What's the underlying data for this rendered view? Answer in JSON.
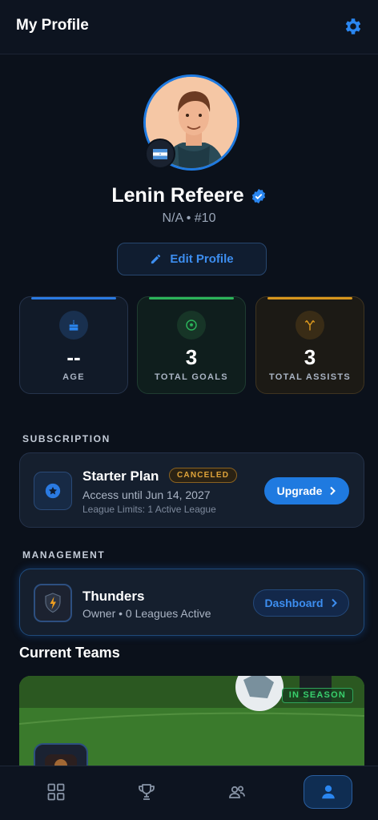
{
  "header": {
    "title": "My Profile",
    "settings_icon": "gear-icon"
  },
  "profile": {
    "name": "Lenin Refeere",
    "subline": "N/A • #10",
    "verified_icon": "verified-check-icon",
    "flag_icon": "honduras-flag-icon",
    "edit_label": "Edit Profile"
  },
  "stats": [
    {
      "value": "--",
      "label": "AGE",
      "icon": "cake-icon",
      "accent": "#2a7ae2"
    },
    {
      "value": "3",
      "label": "TOTAL GOALS",
      "icon": "soccer-ball-icon",
      "accent": "#2bb35a"
    },
    {
      "value": "3",
      "label": "TOTAL ASSISTS",
      "icon": "assist-arrows-icon",
      "accent": "#d7961e"
    }
  ],
  "subscription": {
    "section_label": "SUBSCRIPTION",
    "plan": "Starter Plan",
    "status": "CANCELED",
    "access": "Access until Jun 14, 2027",
    "limits": "League Limits: 1 Active League",
    "button": "Upgrade"
  },
  "management": {
    "section_label": "MANAGEMENT",
    "team": "Thunders",
    "detail": "Owner • 0 Leagues Active",
    "button": "Dashboard"
  },
  "teams": {
    "title": "Current Teams",
    "badge": "IN SEASON"
  },
  "nav": [
    {
      "name": "dashboard",
      "icon": "grid-icon",
      "active": false
    },
    {
      "name": "leagues",
      "icon": "trophy-icon",
      "active": false
    },
    {
      "name": "teams",
      "icon": "people-icon",
      "active": false
    },
    {
      "name": "profile",
      "icon": "person-icon",
      "active": true
    }
  ],
  "colors": {
    "accent": "#1f7ae0",
    "background": "#0b111b",
    "card": "#151f2e"
  }
}
